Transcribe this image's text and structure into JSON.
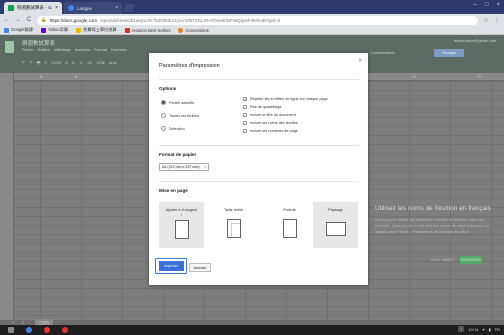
{
  "browser": {
    "tabs": [
      {
        "title": "倒週數試算表 - Googl",
        "close": "×"
      },
      {
        "title": "Langue",
        "close": "×"
      }
    ],
    "window_controls": [
      "–",
      "□",
      "×"
    ],
    "nav": {
      "back": "←",
      "forward": "→",
      "reload": "C"
    },
    "url_host": "https://docs.google.com",
    "url_path": "/spreadsheets/d/1wqzuJm7hdVl0I3r1zy1cm8bTZSLJKAF0oi9KfSFWQqnsF4h0/edit#gid=0",
    "star": "☆",
    "menu": "⋮",
    "bookmarks": [
      {
        "label": "Google翻譯",
        "color": "#4285f4"
      },
      {
        "label": "Yahoo奇摩",
        "color": "#5f01d1"
      },
      {
        "label": "免費線上單位換算",
        "color": "#f4b400"
      },
      {
        "label": "Amazon Best Sellers",
        "color": "#c0392b"
      },
      {
        "label": "Conversions",
        "color": "#e67e22"
      }
    ]
  },
  "sheets": {
    "doc_title": "倒週數試算表",
    "menus": [
      "Fichier",
      "Édition",
      "Affichage",
      "Insertion",
      "Format",
      "Données"
    ],
    "account": "wendy.ttsuei@gmail.com",
    "comments_label": "Commentaires",
    "share_label": "Partager",
    "toolbar": [
      "↶",
      "↷",
      "🖶",
      "⅌",
      "100%",
      "€",
      "%",
      ".0",
      ".00",
      "123▾",
      "Arial"
    ],
    "columns": {
      "a": "A",
      "b": "B",
      "n": "N",
      "o": "O"
    },
    "sidebar": {
      "heading": "Utilisez les noms de fonction en français",
      "body": "Vous pouvez définir vos effets des formules en fonction dans vos formules. Vous pouvez à tout moment choisir de saisir la fonction en anglais dans Fichier > Paramètres de la feuille de calcul.",
      "dismiss": "NON, MERCI",
      "accept": "D'ACCORD"
    },
    "sheet_tab": "工作表1",
    "add_sheet": "+",
    "sheet_list": "≡"
  },
  "dialog": {
    "title": "Paramètres d'impression",
    "close": "×",
    "options_heading": "Options",
    "radios": [
      {
        "label": "Feuille actuelle",
        "checked": true
      },
      {
        "label": "Toutes les feuilles",
        "checked": false
      },
      {
        "label": "Sélection",
        "checked": false
      }
    ],
    "checkboxes": [
      {
        "label": "Répéter les en-têtes de ligne sur chaque page",
        "checked": true
      },
      {
        "label": "Pas de quadrillage",
        "checked": false
      },
      {
        "label": "Inclure le titre du document",
        "checked": false
      },
      {
        "label": "Inclure les noms des feuilles",
        "checked": false
      },
      {
        "label": "Inclure les numéros de page",
        "checked": false
      }
    ],
    "paper_heading": "Format de papier",
    "paper_value": "A4 (210 mm x 297 mm)",
    "paper_caret": "↕",
    "layout_heading": "Mise en page",
    "layouts": [
      {
        "label": "Ajuster à la largeur",
        "selected": true
      },
      {
        "label": "Taille réelle",
        "selected": false
      },
      {
        "label": "Portrait",
        "selected": false
      },
      {
        "label": "Paysage",
        "selected": true
      }
    ],
    "arrow_glyph": "↕",
    "print_label": "Imprimer",
    "cancel_label": "Annuler"
  },
  "taskbar": {
    "tray_time": "10:14",
    "tray_lang": "FR",
    "tray_badge": "1"
  }
}
